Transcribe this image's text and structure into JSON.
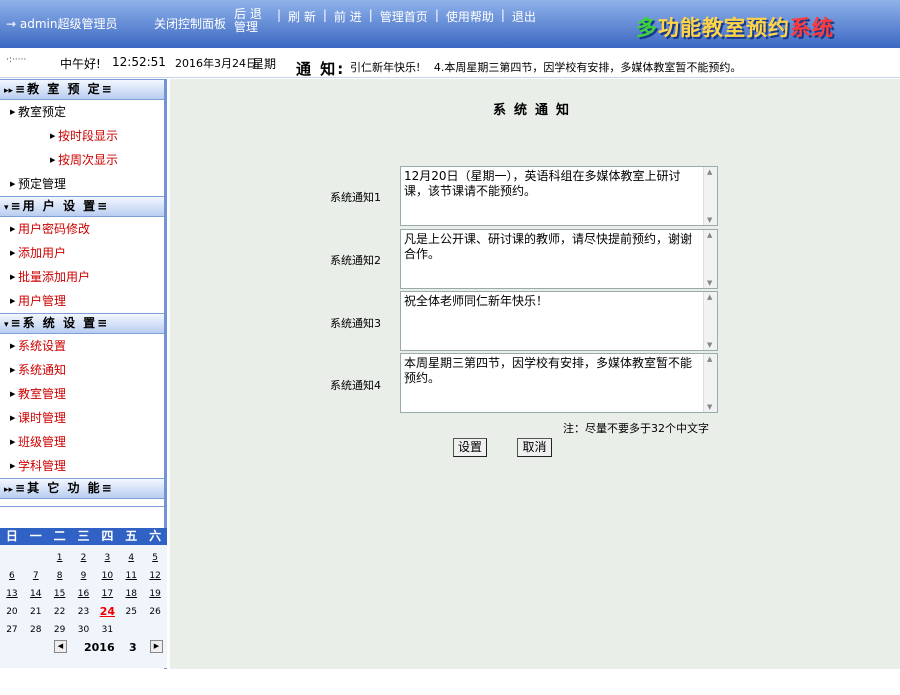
{
  "header": {
    "user": "→ admin超级管理员",
    "close_panel": "关闭控制面板",
    "nav": [
      "后 退\n管理",
      "刷 新",
      "前 进",
      "管理首页",
      "使用帮助",
      "退出"
    ],
    "logo": [
      "多",
      "功能教室预约",
      "系统"
    ]
  },
  "statusbar": {
    "dots_icon": "·:·····",
    "greeting": "中午好!",
    "time": "12:52:51",
    "date": "2016年3月24日",
    "weekday": "星期",
    "notice_label": "通 知:",
    "notices": [
      "引仁新年快乐!",
      "4.本周星期三第四节，因学校有安排，多媒体教室暂不能预约。"
    ]
  },
  "sidebar": {
    "sections": [
      {
        "title": "教 室 预 定",
        "arrow": "▸▸"
      },
      {
        "title": "用 户 设 置",
        "arrow": "▾"
      },
      {
        "title": "系 统 设 置",
        "arrow": "▾"
      },
      {
        "title": "其 它 功 能",
        "arrow": "▸▸"
      }
    ],
    "room_items": [
      "教室预定",
      "按时段显示",
      "按周次显示",
      "预定管理"
    ],
    "user_items": [
      "用户密码修改",
      "添加用户",
      "批量添加用户",
      "用户管理"
    ],
    "system_items": [
      "系统设置",
      "系统通知",
      "教室管理",
      "课时管理",
      "班级管理",
      "学科管理"
    ]
  },
  "calendar": {
    "weekdays": [
      "日",
      "一",
      "二",
      "三",
      "四",
      "五",
      "六"
    ],
    "days": [
      "",
      "",
      "1",
      "2",
      "3",
      "4",
      "5",
      "6",
      "7",
      "8",
      "9",
      "10",
      "11",
      "12",
      "13",
      "14",
      "15",
      "16",
      "17",
      "18",
      "19",
      "20",
      "21",
      "22",
      "23",
      "24",
      "25",
      "26",
      "27",
      "28",
      "29",
      "30",
      "31",
      "",
      ""
    ],
    "today": "24",
    "year": "2016",
    "month": "3"
  },
  "main": {
    "title": "系统通知",
    "fields": [
      {
        "label": "系统通知1",
        "value": "12月20日（星期一），英语科组在多媒体教室上研讨课，该节课请不能预约。"
      },
      {
        "label": "系统通知2",
        "value": "凡是上公开课、研讨课的教师，请尽快提前预约，谢谢合作。"
      },
      {
        "label": "系统通知3",
        "value": "祝全体老师同仁新年快乐！"
      },
      {
        "label": "系统通知4",
        "value": "本周星期三第四节，因学校有安排，多媒体教室暂不能预约。"
      }
    ],
    "note": "注：尽量不要多于32个中文字",
    "save_label": "设置",
    "cancel_label": "取消"
  },
  "colors": {
    "header_bg": "#3c68c2",
    "sidebar_border": "#6f94d8",
    "link_red": "#cc0000",
    "main_bg": "#e9eee9",
    "calendar_header": "#2f62c4"
  }
}
